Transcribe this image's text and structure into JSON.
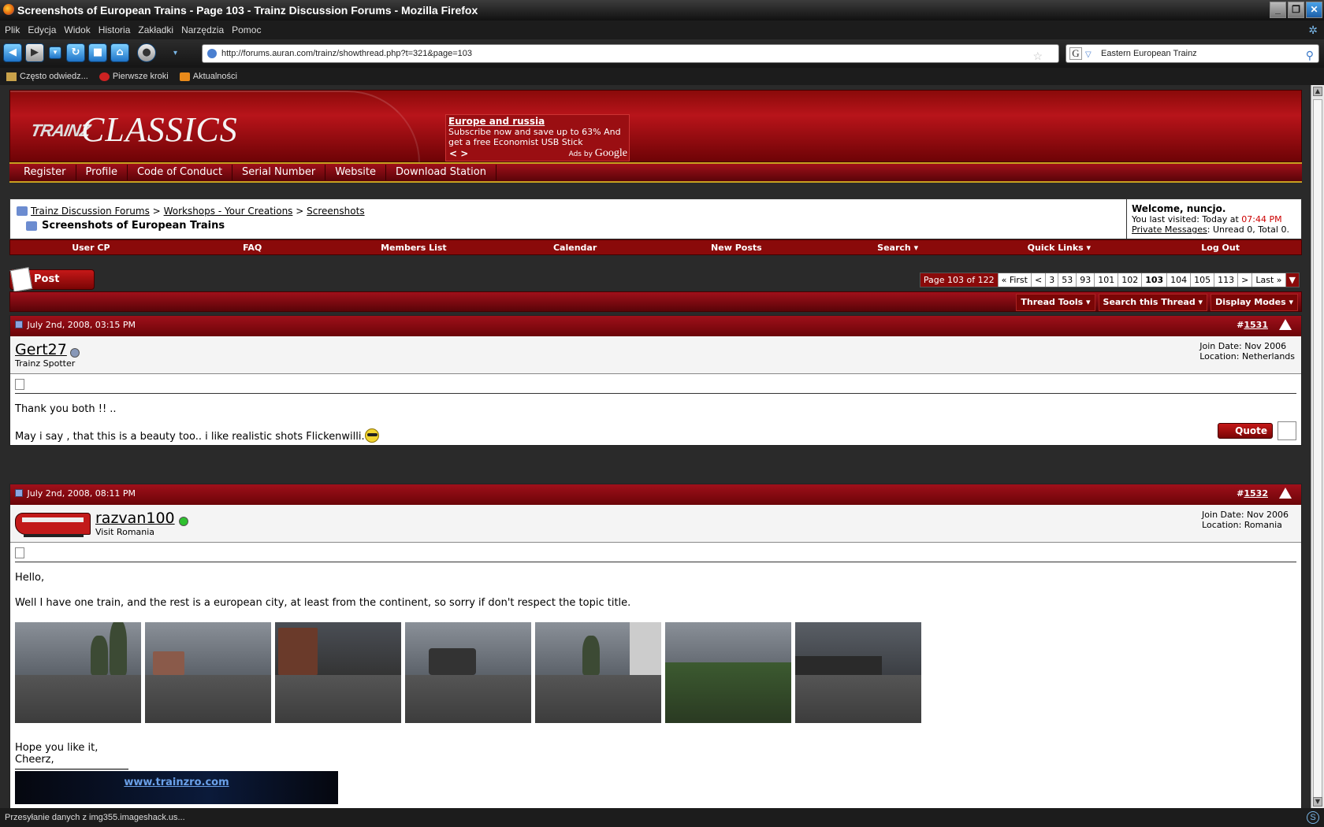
{
  "window": {
    "title": "Screenshots of European Trains - Page 103 - Trainz Discussion Forums - Mozilla Firefox"
  },
  "menu": [
    "Plik",
    "Edycja",
    "Widok",
    "Historia",
    "Zakładki",
    "Narzędzia",
    "Pomoc"
  ],
  "address": {
    "url": "http://forums.auran.com/trainz/showthread.php?t=321&page=103"
  },
  "search": {
    "value": "Eastern European Trainz"
  },
  "bookmarks": [
    "Często odwiedz...",
    "Pierwsze kroki",
    "Aktualności"
  ],
  "site": {
    "logo_trainz": "TRAINZ",
    "logo_classics": "CLASSICS",
    "ad": {
      "title": "Europe and russia",
      "text": "Subscribe now and save up to 63% And get a free Economist USB Stick",
      "nav": "< >",
      "ads_by": "Ads by",
      "google": "Google"
    },
    "topnav": [
      "Register",
      "Profile",
      "Code of Conduct",
      "Serial Number",
      "Website",
      "Download Station"
    ]
  },
  "breadcrumb": {
    "items": [
      "Trainz Discussion Forums",
      "Workshops - Your Creations",
      "Screenshots"
    ],
    "sep": ">",
    "title": "Screenshots of European Trains"
  },
  "welcome": {
    "greeting": "Welcome, nuncjo.",
    "visited_prefix": "You last visited: Today at",
    "visited_time": "07:44 PM",
    "pm_label": "Private Messages",
    "pm_rest": ": Unread 0, Total 0."
  },
  "rednav": [
    "User CP",
    "FAQ",
    "Members List",
    "Calendar",
    "New Posts",
    "Search ▾",
    "Quick Links ▾",
    "Log Out"
  ],
  "post_reply": "Post Reply",
  "pager": {
    "info": "Page 103 of 122",
    "first": "« First",
    "prev": "<",
    "pages": [
      "3",
      "53",
      "93",
      "101",
      "102",
      "103",
      "104",
      "105",
      "113"
    ],
    "current": "103",
    "next": ">",
    "last": "Last »"
  },
  "thread_tools": [
    "Thread Tools ▾",
    "Search this Thread ▾",
    "Display Modes ▾"
  ],
  "posts": [
    {
      "date": "July 2nd, 2008, 03:15 PM",
      "hash": "#",
      "num": "1531",
      "user": "Gert27",
      "user_title": "Trainz Spotter",
      "join": "Join Date: Nov 2006",
      "location": "Location: Netherlands",
      "online": false,
      "lines": [
        "Thank you both !! ..",
        "May i say , that this is a beauty too.. i like realistic shots Flickenwilli."
      ],
      "quote": "Quote"
    },
    {
      "date": "July 2nd, 2008, 08:11 PM",
      "hash": "#",
      "num": "1532",
      "user": "razvan100",
      "user_title": "Visit Romania",
      "join": "Join Date: Nov 2006",
      "location": "Location: Romania",
      "online": true,
      "lines": [
        "Hello,",
        "Well I have one train, and the rest is a european city, at least from the continent, so sorry if don't respect the topic title."
      ],
      "outro": [
        "Hope you like it,",
        "Cheerz,"
      ],
      "sig_banner": "www.trainzro.com",
      "thumb_count": 7
    }
  ],
  "status": {
    "text": "Przesyłanie danych z img355.imageshack.us..."
  },
  "colors": {
    "brand_red": "#8a0a0a",
    "accent_gold": "#c8a020"
  }
}
